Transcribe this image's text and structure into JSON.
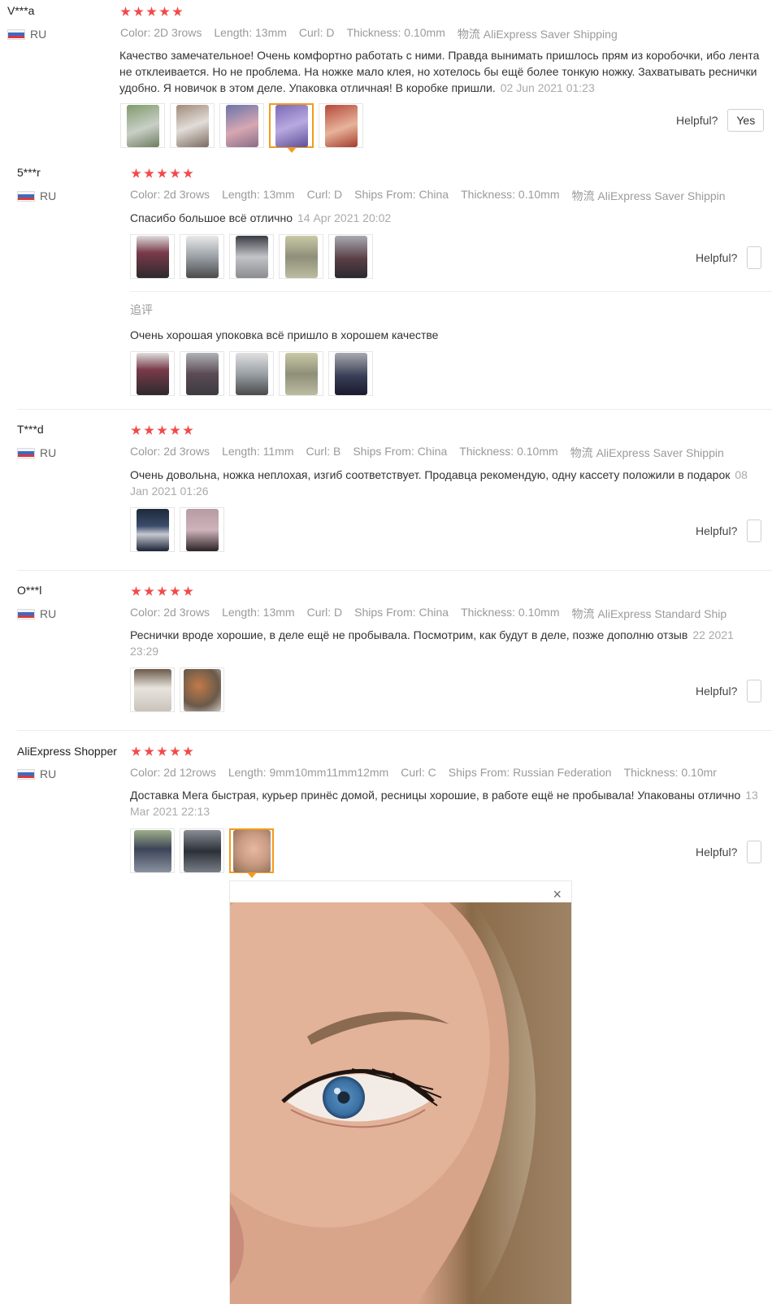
{
  "reviews": [
    {
      "user": "V***a",
      "country": "RU",
      "attrs": [
        {
          "k": "Color:",
          "v": "2D 3rows"
        },
        {
          "k": "Length:",
          "v": "13mm"
        },
        {
          "k": "Curl:",
          "v": "D"
        },
        {
          "k": "Thickness:",
          "v": "0.10mm"
        },
        {
          "k": "物流",
          "v": "AliExpress Saver Shipping"
        }
      ],
      "text": "Качество замечательное! Очень комфортно работать с ними. Правда вынимать пришлось прям из коробочки, ибо лента не отклеивается. Но не проблема. На ножке мало клея, но хотелось бы ещё более тонкую ножку. Захватывать реснички удобно. Я новичок в этом деле. Упаковка отличная! В коробке пришли.",
      "date": "02 Jun 2021 01:23",
      "helpful": "Helpful?",
      "yes": "Yes"
    },
    {
      "user": "5***r",
      "country": "RU",
      "attrs": [
        {
          "k": "Color:",
          "v": "2d 3rows"
        },
        {
          "k": "Length:",
          "v": "13mm"
        },
        {
          "k": "Curl:",
          "v": "D"
        },
        {
          "k": "Ships From:",
          "v": "China"
        },
        {
          "k": "Thickness:",
          "v": "0.10mm"
        },
        {
          "k": "物流",
          "v": "AliExpress Saver Shippin"
        }
      ],
      "text": "Спасибо большое всё отлично",
      "date": "14 Apr 2021 20:02",
      "helpful": "Helpful?",
      "followup_label": "追评",
      "followup_text": "Очень хорошая упоковка всё пришло в хорошем качестве"
    },
    {
      "user": "T***d",
      "country": "RU",
      "attrs": [
        {
          "k": "Color:",
          "v": "2d 3rows"
        },
        {
          "k": "Length:",
          "v": "11mm"
        },
        {
          "k": "Curl:",
          "v": "B"
        },
        {
          "k": "Ships From:",
          "v": "China"
        },
        {
          "k": "Thickness:",
          "v": "0.10mm"
        },
        {
          "k": "物流",
          "v": "AliExpress Saver Shippin"
        }
      ],
      "text": "Очень довольна, ножка неплохая, изгиб соответствует. Продавца рекомендую, одну кассету положили в подарок",
      "date": "08 Jan 2021 01:26",
      "helpful": "Helpful?"
    },
    {
      "user": "O***l",
      "country": "RU",
      "attrs": [
        {
          "k": "Color:",
          "v": "2d 3rows"
        },
        {
          "k": "Length:",
          "v": "13mm"
        },
        {
          "k": "Curl:",
          "v": "D"
        },
        {
          "k": "Ships From:",
          "v": "China"
        },
        {
          "k": "Thickness:",
          "v": "0.10mm"
        },
        {
          "k": "物流",
          "v": "AliExpress Standard Ship"
        }
      ],
      "text": "Реснички вроде хорошие, в деле ещё не пробывала. Посмотрим, как будут в деле, позже дополню отзыв",
      "date": "22 2021 23:29",
      "helpful": "Helpful?"
    },
    {
      "user": "AliExpress Shopper",
      "country": "RU",
      "attrs": [
        {
          "k": "Color:",
          "v": "2d 12rows"
        },
        {
          "k": "Length:",
          "v": "9mm10mm11mm12mm"
        },
        {
          "k": "Curl:",
          "v": "C"
        },
        {
          "k": "Ships From:",
          "v": "Russian Federation"
        },
        {
          "k": "Thickness:",
          "v": "0.10mr"
        }
      ],
      "text": "Доставка Мега быстрая, курьер принёс домой, ресницы хорошие, в работе ещё не пробывала! Упакованы отлично",
      "date": "13 Mar 2021 22:13",
      "helpful": "Helpful?"
    }
  ],
  "popup": {
    "close": "×"
  },
  "colors": {
    "star": "#f24a4a",
    "selected": "#f29b1d"
  }
}
